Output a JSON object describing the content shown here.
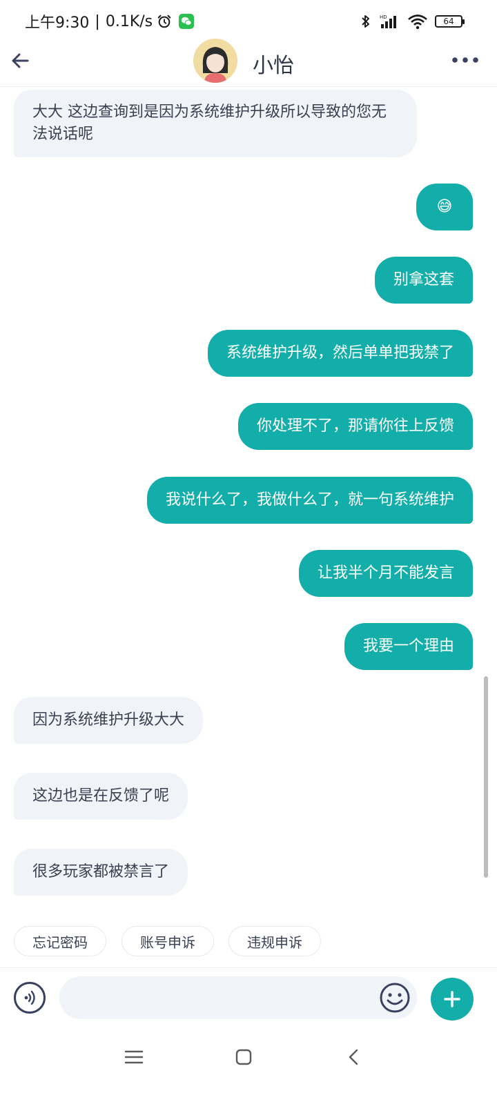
{
  "status_bar": {
    "time": "上午9:30",
    "separator": "|",
    "net_speed": "0.1K/s",
    "battery": "64",
    "icons": [
      "alarm-icon",
      "wechat-icon",
      "bluetooth-icon",
      "hd-signal-icon",
      "wifi-icon",
      "battery-icon"
    ]
  },
  "header": {
    "contact_name": "小怡",
    "icons": [
      "back-arrow-icon",
      "avatar",
      "more-icon"
    ]
  },
  "messages": [
    {
      "side": "in",
      "text": "大大 这边查询到是因为系统维护升级所以导致的您无法说话呢"
    },
    {
      "side": "out",
      "text": "😅"
    },
    {
      "side": "out",
      "text": "别拿这套"
    },
    {
      "side": "out",
      "text": "系统维护升级，然后单单把我禁了"
    },
    {
      "side": "out",
      "text": "你处理不了，那请你往上反馈"
    },
    {
      "side": "out",
      "text": "我说什么了，我做什么了，就一句系统维护"
    },
    {
      "side": "out",
      "text": "让我半个月不能发言"
    },
    {
      "side": "out",
      "text": "我要一个理由"
    },
    {
      "side": "in",
      "text": "因为系统维护升级大大"
    },
    {
      "side": "in",
      "text": "这边也是在反馈了呢"
    },
    {
      "side": "in",
      "text": "很多玩家都被禁言了"
    }
  ],
  "quick_replies": [
    "忘记密码",
    "账号申诉",
    "违规申诉"
  ],
  "input_bar": {
    "value": "",
    "placeholder": "",
    "icons": [
      "voice-icon",
      "emoji-icon",
      "plus-icon"
    ]
  },
  "nav_bar": {
    "icons": [
      "menu-icon",
      "home-icon",
      "back-icon"
    ]
  },
  "colors": {
    "accent": "#13aeaa",
    "incoming_bubble": "#f0f3f7",
    "text_dark": "#2e3447"
  }
}
